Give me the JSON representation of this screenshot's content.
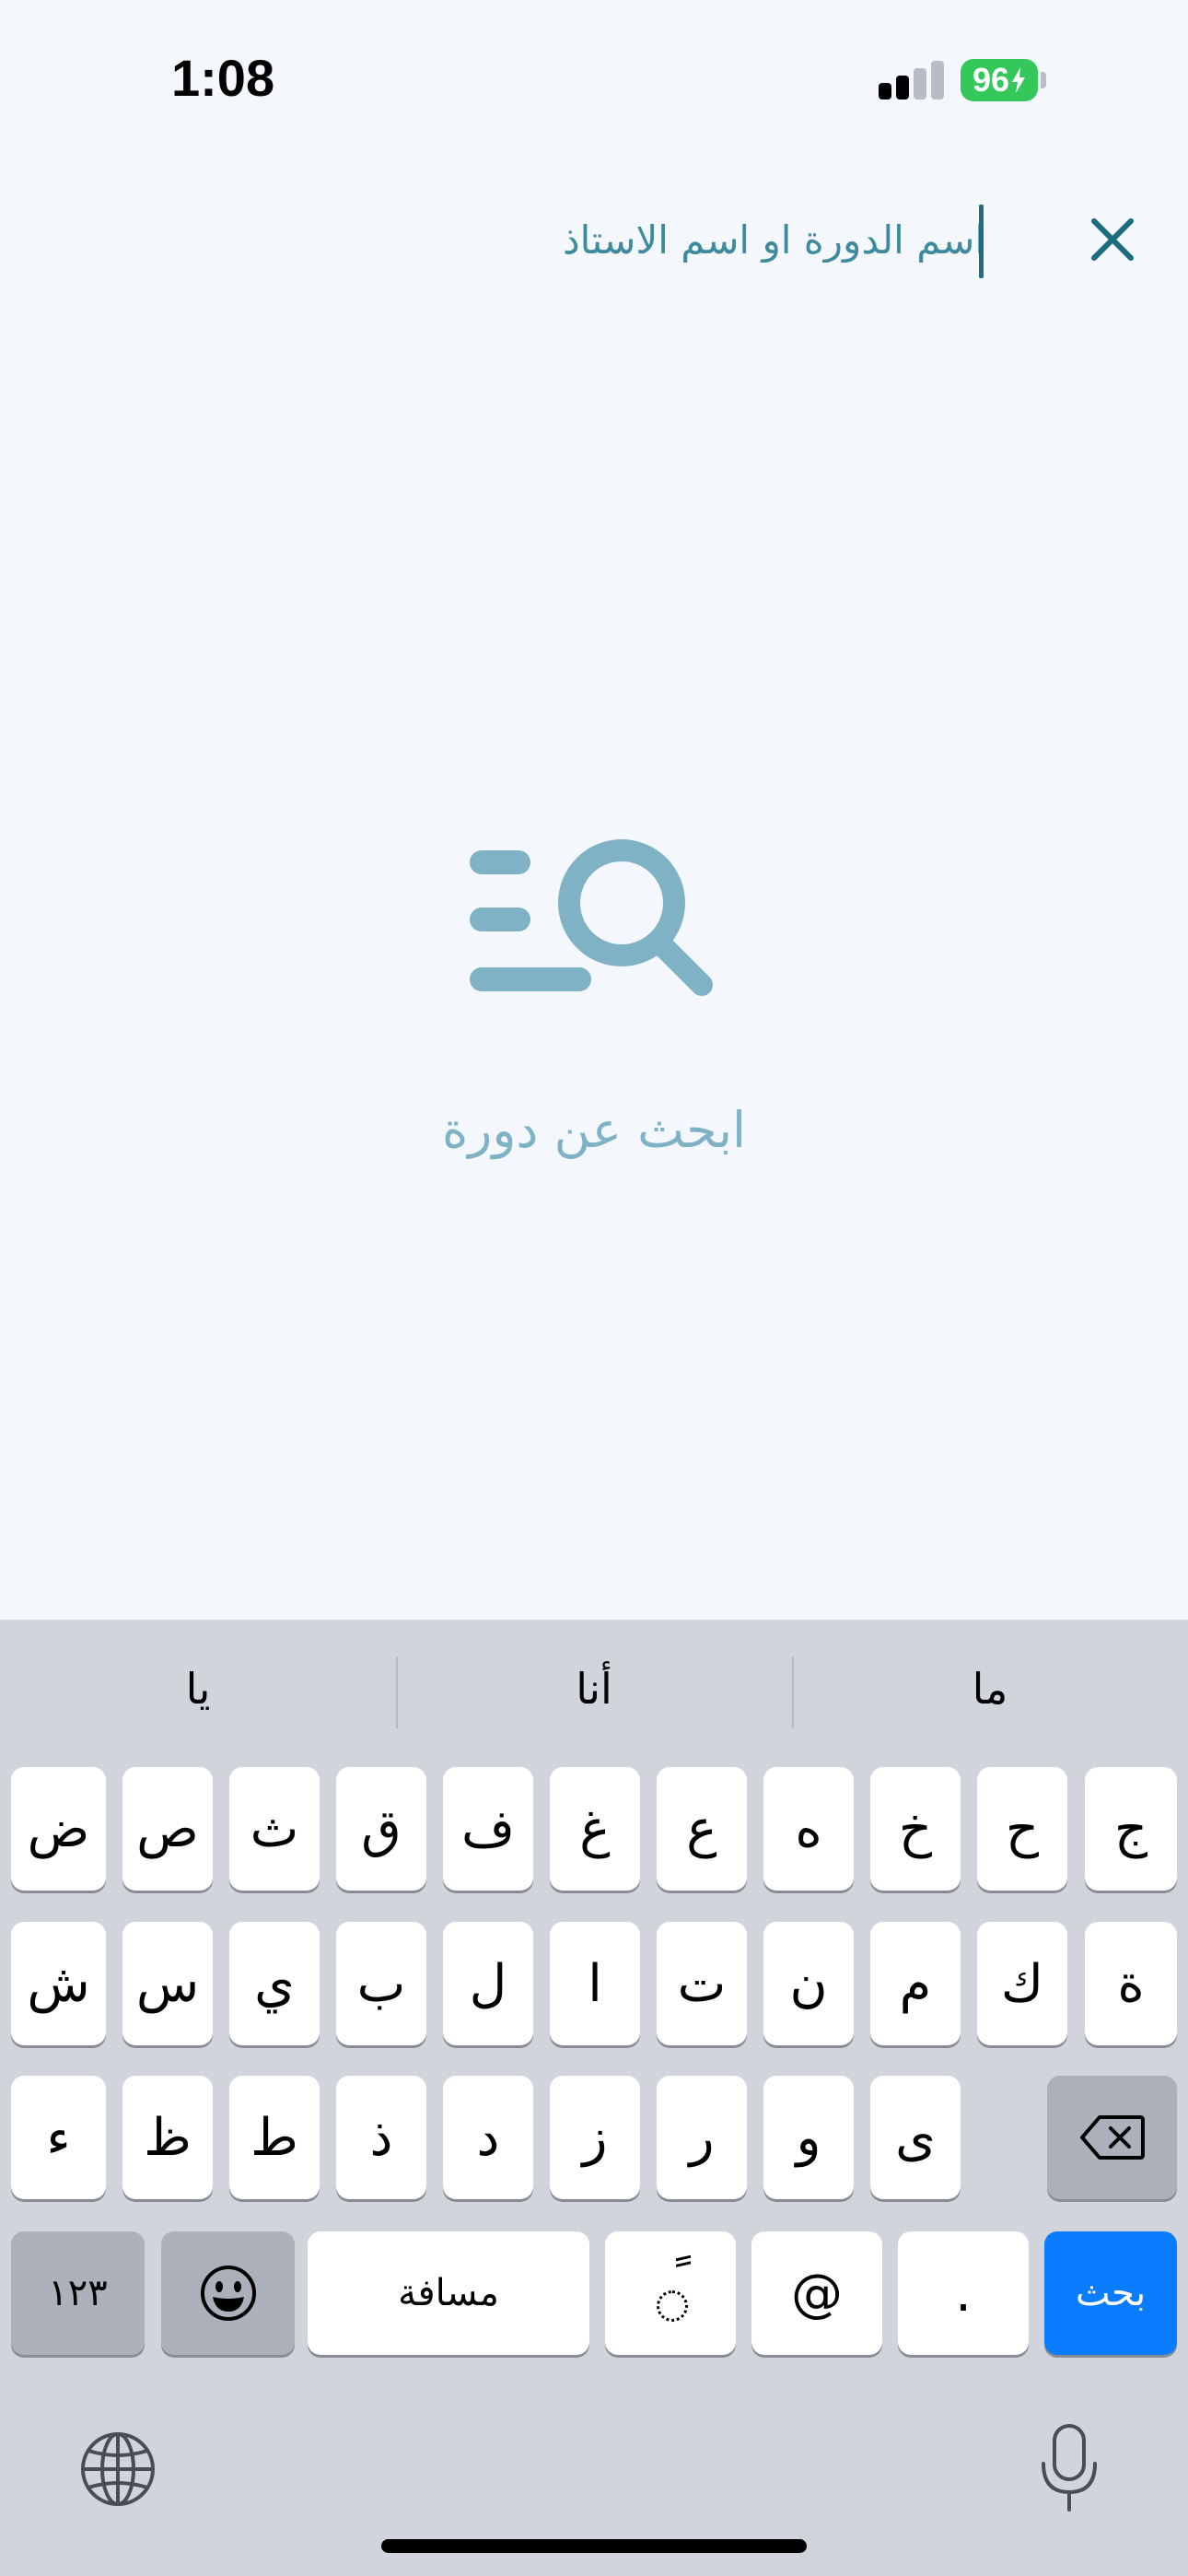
{
  "status_bar": {
    "time": "1:08",
    "battery": "96"
  },
  "search": {
    "placeholder": "اسم الدورة او اسم الاستاذ",
    "close_icon": "close-icon"
  },
  "empty_state": {
    "icon": "search-list-icon",
    "label": "ابحث عن دورة"
  },
  "keyboard": {
    "suggestions": [
      "ما",
      "أنا",
      "يا"
    ],
    "row1": [
      "ج",
      "ح",
      "خ",
      "ه",
      "ع",
      "غ",
      "ف",
      "ق",
      "ث",
      "ص",
      "ض"
    ],
    "row2": [
      "ة",
      "ك",
      "م",
      "ن",
      "ت",
      "ا",
      "ل",
      "ب",
      "ي",
      "س",
      "ش"
    ],
    "row3": [
      "ى",
      "و",
      "ر",
      "ز",
      "د",
      "ذ",
      "ط",
      "ظ",
      "ء"
    ],
    "numbers_key": "١٢٣",
    "space_key": "مسافة",
    "tanween_key": "ً",
    "at_key": "@",
    "period_key": ".",
    "search_key": "بحث"
  },
  "colors": {
    "background": "#f4f8fd",
    "accent": "#2f7e90",
    "empty_icon": "#7fb2c5",
    "keyboard_bg": "#d1d4db",
    "search_key": "#0a7cff",
    "battery": "#34c759"
  }
}
